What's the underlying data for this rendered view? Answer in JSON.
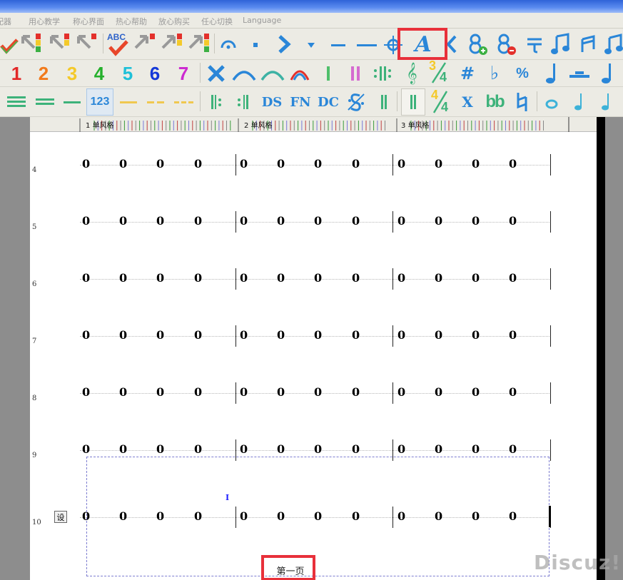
{
  "menu": [
    "配器",
    "用心教学",
    "称心界面",
    "热心帮助",
    "放心购买",
    "任心切换",
    "Language"
  ],
  "toolbar1": {
    "icons": [
      "check-down-icon",
      "arrow-red-green-icon",
      "arrow-yellow-icon",
      "arrow-red-icon",
      "spellcheck-abc-icon",
      "arrow-red-2-icon",
      "arrow-yellow-2-icon",
      "arrow-multi-icon",
      "fermata-icon",
      "dot-icon",
      "chevron-right-icon",
      "triangle-down-icon",
      "dash-short-icon",
      "dash-long-icon",
      "crosshair-icon",
      "text-a-icon",
      "chevron-left-icon",
      "eight-add-icon",
      "eight-remove-icon",
      "tie-bracket-icon",
      "double-note-icon",
      "beam-note-icon",
      "beam-note-2-icon"
    ],
    "abc_label": "ABC",
    "text_a_label": "A"
  },
  "toolbar2": {
    "digits": [
      "1",
      "2",
      "3",
      "4",
      "5",
      "6",
      "7"
    ],
    "digit_colors": [
      "#e22828",
      "#f27a1b",
      "#f4c92a",
      "#25b02c",
      "#1ec0d8",
      "#1438d8",
      "#cc2bd0"
    ],
    "icons": [
      "x-icon",
      "slur-arc-icon",
      "slur-arc-teal-icon",
      "arc-red-icon",
      "barline-single-icon",
      "barline-double-icon",
      "repeat-dots-icon",
      "treble-clef-icon",
      "time-sig-34-icon",
      "sharp-icon",
      "flat-icon",
      "percent-icon",
      "quarter-note-icon",
      "rest-bar-icon",
      "eighth-note-icon"
    ],
    "time_sig_top": "3",
    "time_sig_bottom": "4",
    "sharp_label": "#",
    "flat_label": "♭",
    "percent_label": "%"
  },
  "toolbar3": {
    "icons": [
      "lines-3-icon",
      "lines-2-icon",
      "line-1-icon",
      "numbered-123-icon",
      "dash-yellow-icon",
      "dash-yellow-2-icon",
      "dash-yellow-3-icon",
      "repeat-start-icon",
      "repeat-end-icon",
      "ds-icon",
      "fn-icon",
      "dc-icon",
      "segno-icon",
      "barline-icon",
      "barline-active-icon",
      "time-sig-44-icon",
      "x-mark-icon",
      "double-flat-icon",
      "natural-icon",
      "whole-note-icon",
      "grace-note-icon",
      "grace-note-2-icon"
    ],
    "numbered_label": "123",
    "ds_label": "DS",
    "fn_label": "FN",
    "dc_label": "DC",
    "x_label": "X",
    "double_flat_label": "bb",
    "time_top": "4",
    "time_bottom": "4"
  },
  "ruler": {
    "measures": [
      {
        "num": "1",
        "label": "单风格"
      },
      {
        "num": "2",
        "label": "单风格"
      },
      {
        "num": "3",
        "label": "单风格"
      }
    ]
  },
  "score": {
    "rows": [
      {
        "num": "4",
        "notes": [
          "0",
          "0",
          "0",
          "0",
          "0",
          "0",
          "0",
          "0",
          "0",
          "0",
          "0",
          "0"
        ]
      },
      {
        "num": "5",
        "notes": [
          "0",
          "0",
          "0",
          "0",
          "0",
          "0",
          "0",
          "0",
          "0",
          "0",
          "0",
          "0"
        ]
      },
      {
        "num": "6",
        "notes": [
          "0",
          "0",
          "0",
          "0",
          "0",
          "0",
          "0",
          "0",
          "0",
          "0",
          "0",
          "0"
        ]
      },
      {
        "num": "7",
        "notes": [
          "0",
          "0",
          "0",
          "0",
          "0",
          "0",
          "0",
          "0",
          "0",
          "0",
          "0",
          "0"
        ]
      },
      {
        "num": "8",
        "notes": [
          "0",
          "0",
          "0",
          "0",
          "0",
          "0",
          "0",
          "0",
          "0",
          "0",
          "0",
          "0"
        ]
      },
      {
        "num": "9",
        "notes": [
          "0",
          "0",
          "0",
          "0",
          "0",
          "0",
          "0",
          "0",
          "0",
          "0",
          "0",
          "0"
        ]
      },
      {
        "num": "10",
        "notes": [
          "0",
          "0",
          "0",
          "0",
          "0",
          "0",
          "0",
          "0",
          "0",
          "0",
          "0",
          "0"
        ]
      }
    ]
  },
  "set_button": "设",
  "cursor_glyph": "I",
  "page_label": "第一页",
  "watermark": "Discuz!",
  "colors": {
    "highlight": "#e8303a",
    "accent_blue": "#2a86d8",
    "accent_green": "#3db27a"
  }
}
